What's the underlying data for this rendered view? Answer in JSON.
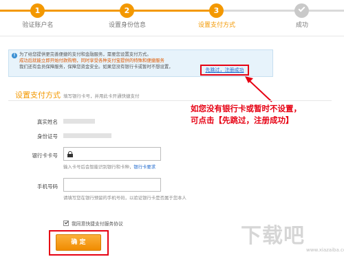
{
  "steps": [
    {
      "number": "1",
      "label": "验证账户名"
    },
    {
      "number": "2",
      "label": "设置身份信息"
    },
    {
      "number": "3",
      "label": "设置支付方式"
    },
    {
      "number": "",
      "label": "成功"
    }
  ],
  "notice": {
    "line1": "为了给您提供更完善便捷的支付和金融服务，需要您设置支付方式。",
    "line2": "成功后就能立即开始付款购物，同时享受各种支付宝提供的特殊和便捷服务",
    "line3": "我们还有会员保障服务，保障您资金安全。如果您没有银行卡或暂时不想设置，",
    "skip_link": "先跳过，注册成功"
  },
  "section": {
    "title": "设置支付方式",
    "subtitle": "填写银行卡号，并用此卡开通快捷支付"
  },
  "form": {
    "real_name_label": "真实姓名",
    "id_number_label": "身份证号",
    "card_label": "银行卡卡号",
    "card_value": "",
    "card_hint": "输入卡号后会智能识别银行和卡种，",
    "card_hint_link": "银行卡要求",
    "phone_label": "手机号码",
    "phone_value": "",
    "phone_hint": "请填写您在银行预留的手机号码，以验证银行卡是否属于您本人",
    "agree_text": "我同意快捷支付服务协议",
    "confirm": "确 定"
  },
  "annotation": {
    "line1": "如您没有银行卡或暂时不设置，",
    "line2": "可点击【先跳过，注册成功】"
  },
  "watermark": {
    "text": "下载吧",
    "sub": "www.xiazaiba.com"
  },
  "colors": {
    "accent": "#f39800",
    "annotation_red": "#e60012",
    "link_blue": "#1a66cc"
  }
}
